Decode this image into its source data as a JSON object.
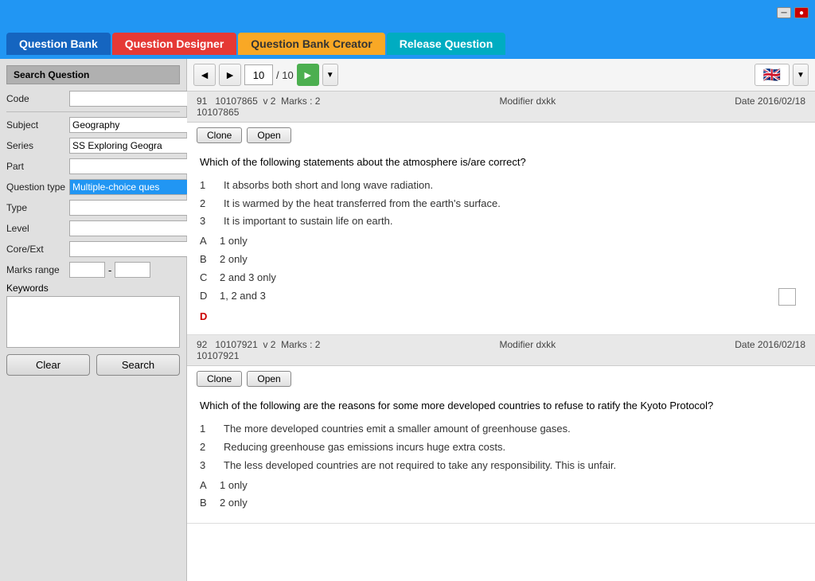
{
  "titlebar": {
    "minimize_icon": "─",
    "close_icon": "●"
  },
  "tabs": [
    {
      "id": "question-bank",
      "label": "Question Bank",
      "style": "active-blue"
    },
    {
      "id": "question-designer",
      "label": "Question Designer",
      "style": "active-red"
    },
    {
      "id": "question-bank-creator",
      "label": "Question Bank Creator",
      "style": "active-yellow"
    },
    {
      "id": "release-question",
      "label": "Release Question",
      "style": "active-teal"
    }
  ],
  "left_panel": {
    "title": "Search Question",
    "fields": {
      "code_label": "Code",
      "subject_label": "Subject",
      "subject_value": "Geography",
      "series_label": "Series",
      "series_value": "SS Exploring Geogra",
      "part_label": "Part",
      "question_type_label": "Question type",
      "question_type_value": "Multiple-choice ques",
      "type_label": "Type",
      "level_label": "Level",
      "core_ext_label": "Core/Ext",
      "marks_range_label": "Marks range",
      "keywords_label": "Keywords"
    },
    "buttons": {
      "clear_label": "Clear",
      "search_label": "Search"
    }
  },
  "toolbar": {
    "prev_icon": "◄",
    "next_icon": "►",
    "page_current": "10",
    "page_separator": "/ 10",
    "play_icon": "►",
    "dropdown_icon": "▼",
    "flag": "🇬🇧"
  },
  "questions": [
    {
      "id": "91",
      "code": "10107865",
      "version": "v 2",
      "marks": "Marks : 2",
      "modifier": "Modifier dxkk",
      "date": "Date 2016/02/18",
      "code2": "10107865",
      "clone_label": "Clone",
      "open_label": "Open",
      "question_text": "Which of the following statements about the atmosphere is/are correct?",
      "items": [
        {
          "num": "1",
          "text": "It absorbs both short and long wave radiation."
        },
        {
          "num": "2",
          "text": "It is warmed by the heat transferred from the earth's surface."
        },
        {
          "num": "3",
          "text": "It is important to sustain life on earth."
        }
      ],
      "options": [
        {
          "letter": "A",
          "text": "1 only",
          "correct": false
        },
        {
          "letter": "B",
          "text": "2 only",
          "correct": false
        },
        {
          "letter": "C",
          "text": "2 and 3 only",
          "correct": false
        },
        {
          "letter": "D",
          "text": "1, 2 and 3",
          "correct": false
        }
      ],
      "answer": "D",
      "has_checkbox": true
    },
    {
      "id": "92",
      "code": "10107921",
      "version": "v 2",
      "marks": "Marks : 2",
      "modifier": "Modifier dxkk",
      "date": "Date 2016/02/18",
      "code2": "10107921",
      "clone_label": "Clone",
      "open_label": "Open",
      "question_text": "Which of the following are the reasons for some more developed countries to refuse to ratify the Kyoto Protocol?",
      "items": [
        {
          "num": "1",
          "text": "The more developed countries emit a smaller amount of greenhouse gases."
        },
        {
          "num": "2",
          "text": "Reducing greenhouse gas emissions incurs huge extra costs."
        },
        {
          "num": "3",
          "text": "The less developed countries are not required to take any responsibility. This is unfair."
        }
      ],
      "options": [
        {
          "letter": "A",
          "text": "1 only",
          "correct": false
        },
        {
          "letter": "B",
          "text": "2 only",
          "correct": false
        }
      ],
      "answer": "",
      "has_checkbox": false
    }
  ]
}
